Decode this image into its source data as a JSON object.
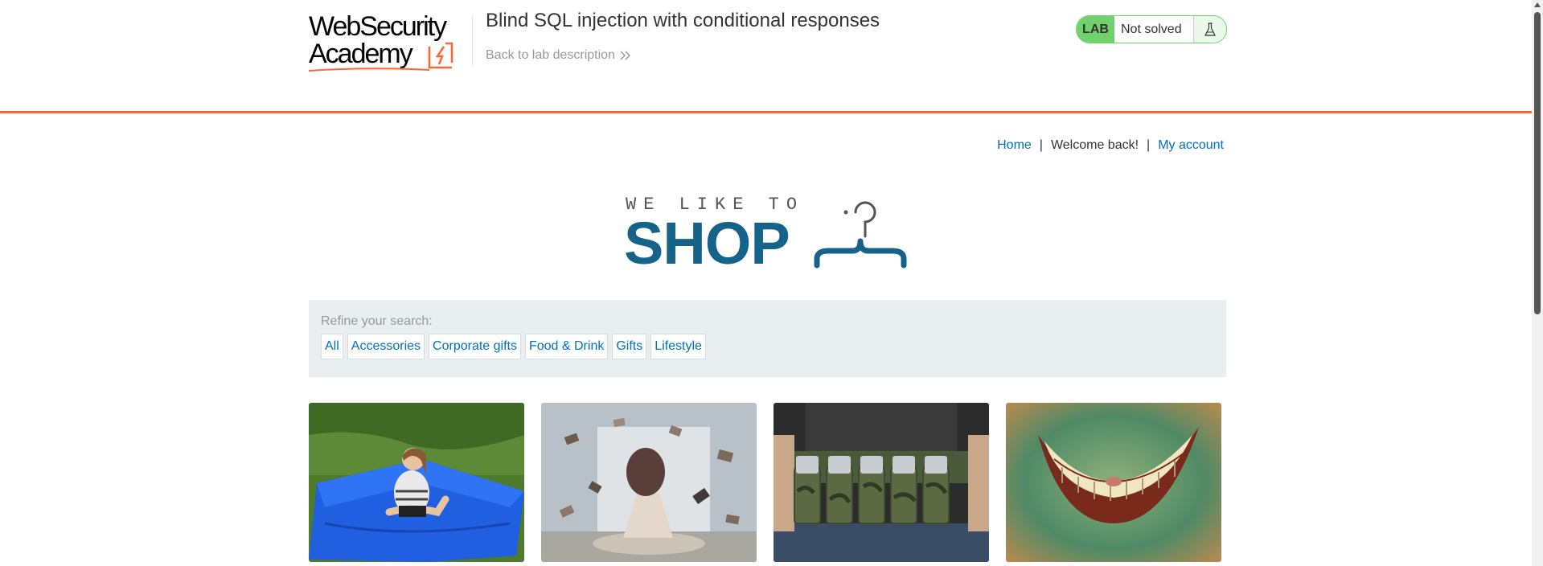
{
  "academy": {
    "logo_line1": "WebSecurity",
    "logo_line2": "Academy",
    "logo_icon": "lightning-bolt-icon",
    "lab_title": "Blind SQL injection with conditional responses",
    "back_link": "Back to lab description",
    "back_icon": "double-chevron-right-icon",
    "lab_badge": "LAB",
    "lab_status": "Not solved",
    "lab_status_icon": "flask-icon",
    "accent_color": "#ff6633",
    "status_color": "#70d16d"
  },
  "nav": {
    "home": "Home",
    "welcome": "Welcome back!",
    "separator": "|",
    "my_account": "My account",
    "link_color": "#0071bc"
  },
  "shop_logo": {
    "tagline": "WE LIKE TO",
    "word": "SHOP",
    "icon": "hanger-icon",
    "brand_color": "#16638a"
  },
  "filters": {
    "label": "Refine your search:",
    "items": [
      "All",
      "Accessories",
      "Corporate gifts",
      "Food & Drink",
      "Gifts",
      "Lifestyle"
    ]
  },
  "products": [
    {
      "image": "blue-bean-bag-girl-image"
    },
    {
      "image": "floating-books-woman-image"
    },
    {
      "image": "beer-can-belt-image"
    },
    {
      "image": "cheshire-cat-grin-image"
    }
  ]
}
